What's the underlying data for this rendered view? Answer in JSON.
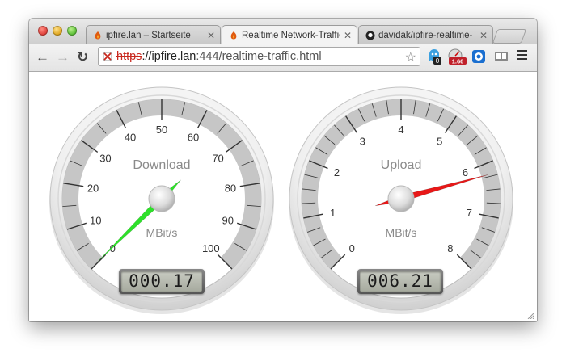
{
  "tabs": [
    {
      "title": "ipfire.lan – Startseite",
      "active": false
    },
    {
      "title": "Realtime Network-Traffic",
      "active": true
    },
    {
      "title": "davidak/ipfire-realtime-",
      "active": false
    }
  ],
  "address_bar": {
    "scheme": "https",
    "host": "://ipfire.lan",
    "rest": ":444/realtime-traffic.html"
  },
  "extensions": {
    "badge_1": "0",
    "badge_2": "1.66"
  },
  "gauges": [
    {
      "title": "Download",
      "unit": "MBit/s",
      "ticks": [
        "0",
        "10",
        "20",
        "30",
        "40",
        "50",
        "60",
        "70",
        "80",
        "90",
        "100"
      ],
      "value": 0.17,
      "max": 100,
      "display": "000.17",
      "needle_color": "#2ee02a"
    },
    {
      "title": "Upload",
      "unit": "MBit/s",
      "ticks": [
        "0",
        "1",
        "2",
        "3",
        "4",
        "5",
        "6",
        "7",
        "8"
      ],
      "value": 6.21,
      "max": 8,
      "display": "006.21",
      "needle_color": "#e81818"
    }
  ]
}
